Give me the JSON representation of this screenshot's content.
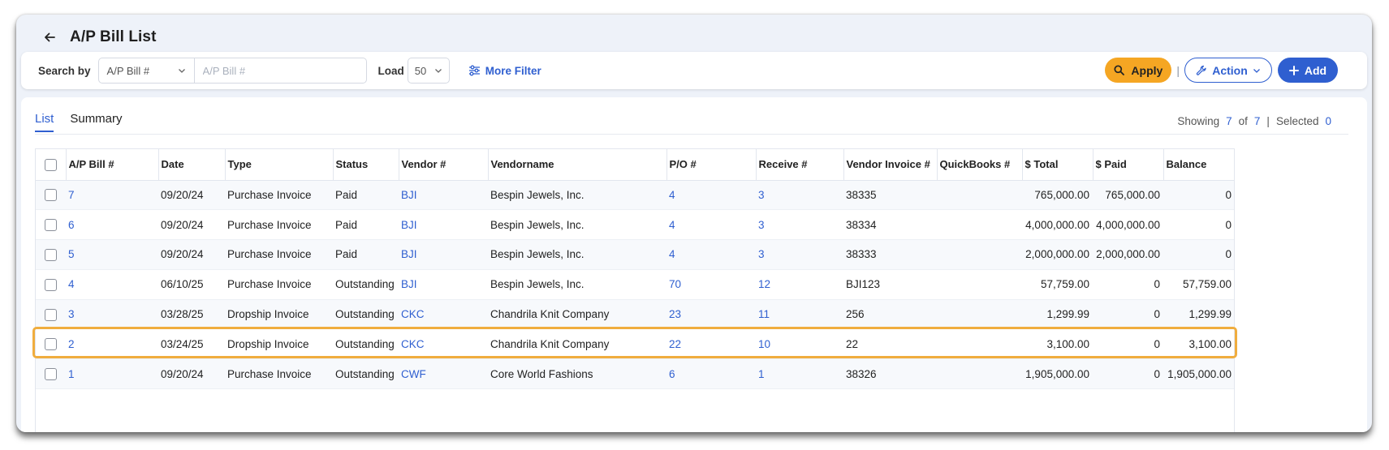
{
  "header": {
    "title": "A/P Bill List"
  },
  "toolbar": {
    "search_by_label": "Search by",
    "search_field_value": "A/P Bill #",
    "search_placeholder": "A/P Bill #",
    "load_label": "Load",
    "load_value": "50",
    "more_filter_label": "More Filter",
    "apply_label": "Apply",
    "separator": "|",
    "action_label": "Action",
    "add_label": "Add"
  },
  "tabs": [
    {
      "label": "List",
      "active": true
    },
    {
      "label": "Summary",
      "active": false
    }
  ],
  "showing": {
    "label": "Showing",
    "shown": "7",
    "of_label": "of",
    "total": "7",
    "sep": "|",
    "selected_label": "Selected",
    "selected": "0"
  },
  "table": {
    "columns": [
      "A/P Bill #",
      "Date",
      "Type",
      "Status",
      "Vendor #",
      "Vendorname",
      "P/O #",
      "Receive #",
      "Vendor Invoice #",
      "QuickBooks #",
      "$ Total",
      "$ Paid",
      "Balance"
    ],
    "rows": [
      {
        "bill": "7",
        "date": "09/20/24",
        "type": "Purchase Invoice",
        "status": "Paid",
        "vendor": "BJI",
        "vendorname": "Bespin Jewels, Inc.",
        "po": "4",
        "receive": "3",
        "vendor_invoice": "38335",
        "quickbooks": "",
        "total": "765,000.00",
        "paid": "765,000.00",
        "balance": "0"
      },
      {
        "bill": "6",
        "date": "09/20/24",
        "type": "Purchase Invoice",
        "status": "Paid",
        "vendor": "BJI",
        "vendorname": "Bespin Jewels, Inc.",
        "po": "4",
        "receive": "3",
        "vendor_invoice": "38334",
        "quickbooks": "",
        "total": "4,000,000.00",
        "paid": "4,000,000.00",
        "balance": "0"
      },
      {
        "bill": "5",
        "date": "09/20/24",
        "type": "Purchase Invoice",
        "status": "Paid",
        "vendor": "BJI",
        "vendorname": "Bespin Jewels, Inc.",
        "po": "4",
        "receive": "3",
        "vendor_invoice": "38333",
        "quickbooks": "",
        "total": "2,000,000.00",
        "paid": "2,000,000.00",
        "balance": "0"
      },
      {
        "bill": "4",
        "date": "06/10/25",
        "type": "Purchase Invoice",
        "status": "Outstanding",
        "vendor": "BJI",
        "vendorname": "Bespin Jewels, Inc.",
        "po": "70",
        "receive": "12",
        "vendor_invoice": "BJI123",
        "quickbooks": "",
        "total": "57,759.00",
        "paid": "0",
        "balance": "57,759.00"
      },
      {
        "bill": "3",
        "date": "03/28/25",
        "type": "Dropship Invoice",
        "status": "Outstanding",
        "vendor": "CKC",
        "vendorname": "Chandrila Knit Company",
        "po": "23",
        "receive": "11",
        "vendor_invoice": "256",
        "quickbooks": "",
        "total": "1,299.99",
        "paid": "0",
        "balance": "1,299.99"
      },
      {
        "bill": "2",
        "date": "03/24/25",
        "type": "Dropship Invoice",
        "status": "Outstanding",
        "vendor": "CKC",
        "vendorname": "Chandrila Knit Company",
        "po": "22",
        "receive": "10",
        "vendor_invoice": "22",
        "quickbooks": "",
        "total": "3,100.00",
        "paid": "0",
        "balance": "3,100.00"
      },
      {
        "bill": "1",
        "date": "09/20/24",
        "type": "Purchase Invoice",
        "status": "Outstanding",
        "vendor": "CWF",
        "vendorname": "Core World Fashions",
        "po": "6",
        "receive": "1",
        "vendor_invoice": "38326",
        "quickbooks": "",
        "total": "1,905,000.00",
        "paid": "0",
        "balance": "1,905,000.00"
      }
    ]
  },
  "colors": {
    "accent": "#2f5fd0",
    "apply": "#f5a623",
    "highlight": "#f0ad3e"
  },
  "icons": [
    "back-arrow-icon",
    "chevron-down-icon",
    "filter-sliders-icon",
    "search-icon",
    "wrench-icon",
    "plus-icon"
  ]
}
